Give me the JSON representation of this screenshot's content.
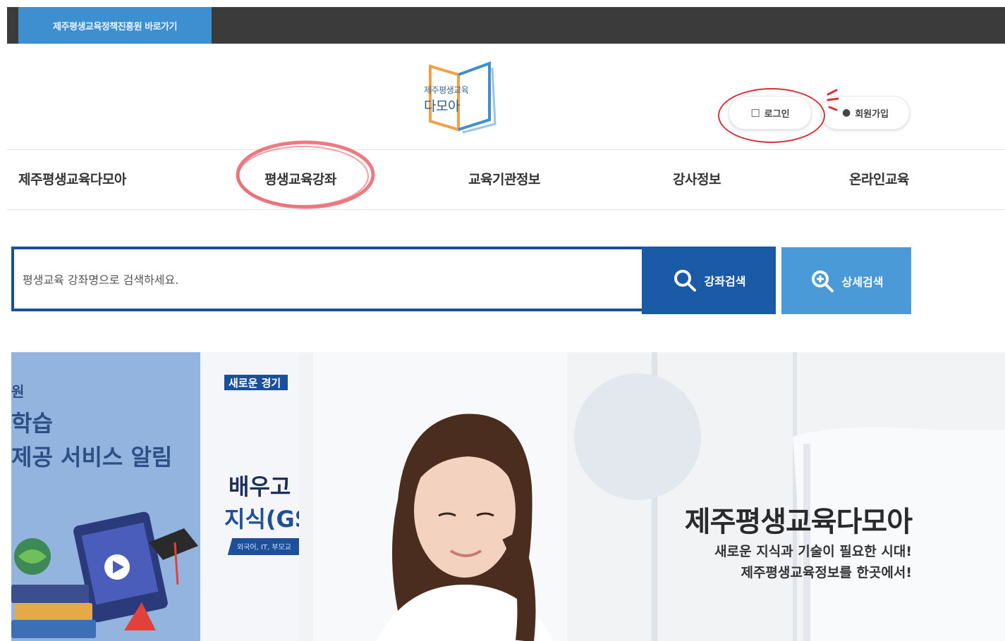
{
  "topbar": {
    "link_label": "제주평생교육정책진흥원 바로가기"
  },
  "logo": {
    "line1": "제주평생교육",
    "line2": "다모아"
  },
  "account": {
    "login_label": "로그인",
    "join_label": "회원가입"
  },
  "nav": {
    "items": [
      {
        "label": "제주평생교육다모아"
      },
      {
        "label": "평생교육강좌"
      },
      {
        "label": "교육기관정보"
      },
      {
        "label": "강사정보"
      },
      {
        "label": "온라인교육"
      }
    ]
  },
  "search": {
    "placeholder": "평생교육 강좌명으로 검색하세요.",
    "search_button": "강좌검색",
    "detail_button": "상세검색"
  },
  "banner": {
    "slide_a": {
      "line1": "원",
      "line2": "학습",
      "line3": "제공 서비스 알림"
    },
    "slide_b": {
      "badge": "새로운 경기",
      "line1": "배우고",
      "line2": "지식(GS",
      "line3": "외국어, IT, 부모교"
    },
    "slide_c": {
      "title": "제주평생교육다모아",
      "sub1": "새로운 지식과 기술이 필요한 시대!",
      "sub2": "제주평생교육정보를 한곳에서!"
    }
  },
  "colors": {
    "topbar": "#3b3b3b",
    "topbar_link": "#3d8fd0",
    "search_border": "#1a4f96",
    "search_button": "#1a5aa6",
    "detail_button": "#4a9ad8",
    "annotation_red": "#d4343a",
    "annotation_pink": "#e8636b"
  },
  "icons": {
    "login": "lock-icon",
    "join": "user-icon",
    "search": "search-icon",
    "detail": "zoom-plus-icon"
  }
}
